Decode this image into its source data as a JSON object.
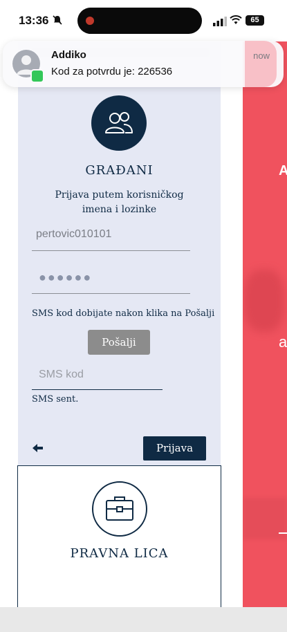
{
  "status_bar": {
    "time": "13:36",
    "battery": "65"
  },
  "notification": {
    "app_name": "Addiko",
    "message": "Kod za potvrdu je: 226536",
    "time": "now"
  },
  "gradjani": {
    "title": "GRAĐANI",
    "subtitle": "Prijava putem korisničkog imena i lozinke",
    "username_value": "pertovic010101",
    "password_mask": "●●●●●●",
    "sms_info": "SMS kod dobijate nakon klika na Pošalji",
    "send_button": "Pošalji",
    "sms_placeholder": "SMS kod",
    "sms_status": "SMS sent.",
    "login_button": "Prijava"
  },
  "pravna": {
    "title": "PRAVNA LICA"
  },
  "right_panel": {
    "letter_1": "A",
    "letter_2": "a"
  },
  "colors": {
    "navy": "#0f2a44",
    "panel_bg": "#e5e8f4",
    "red": "#f0525e",
    "send_button": "#8c8c8c"
  }
}
